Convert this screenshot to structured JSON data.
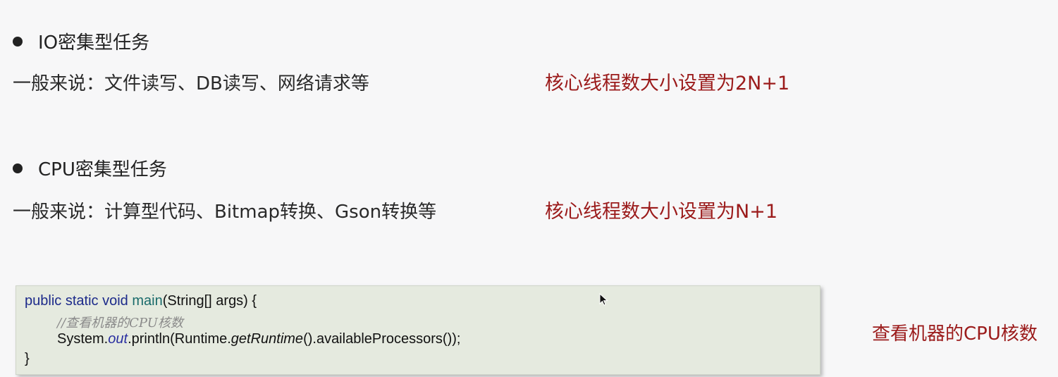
{
  "io_section": {
    "heading": "IO密集型任务",
    "description": "一般来说：文件读写、DB读写、网络请求等",
    "note": "核心线程数大小设置为2N+1"
  },
  "cpu_section": {
    "heading": "CPU密集型任务",
    "description": "一般来说：计算型代码、Bitmap转换、Gson转换等",
    "note": "核心线程数大小设置为N+1"
  },
  "code": {
    "kw_public": "public",
    "kw_static": "static",
    "kw_void": "void",
    "method_main": "main",
    "signature_rest": "(String[] args) {",
    "comment": "//查看机器的CPU核数",
    "call_system": "System.",
    "call_out": "out",
    "call_println": ".println(Runtime.",
    "call_getRuntime": "getRuntime",
    "call_rest": "().availableProcessors());",
    "closing_brace": "}"
  },
  "code_note": "查看机器的CPU核数",
  "colors": {
    "note_red": "#9b1b1b",
    "code_bg": "#e5eadf",
    "keyword_blue": "#1c2a8a",
    "method_teal": "#1a6b6b"
  },
  "icons": {
    "cursor": "mouse-pointer-icon",
    "bullet": "filled-circle-bullet"
  }
}
